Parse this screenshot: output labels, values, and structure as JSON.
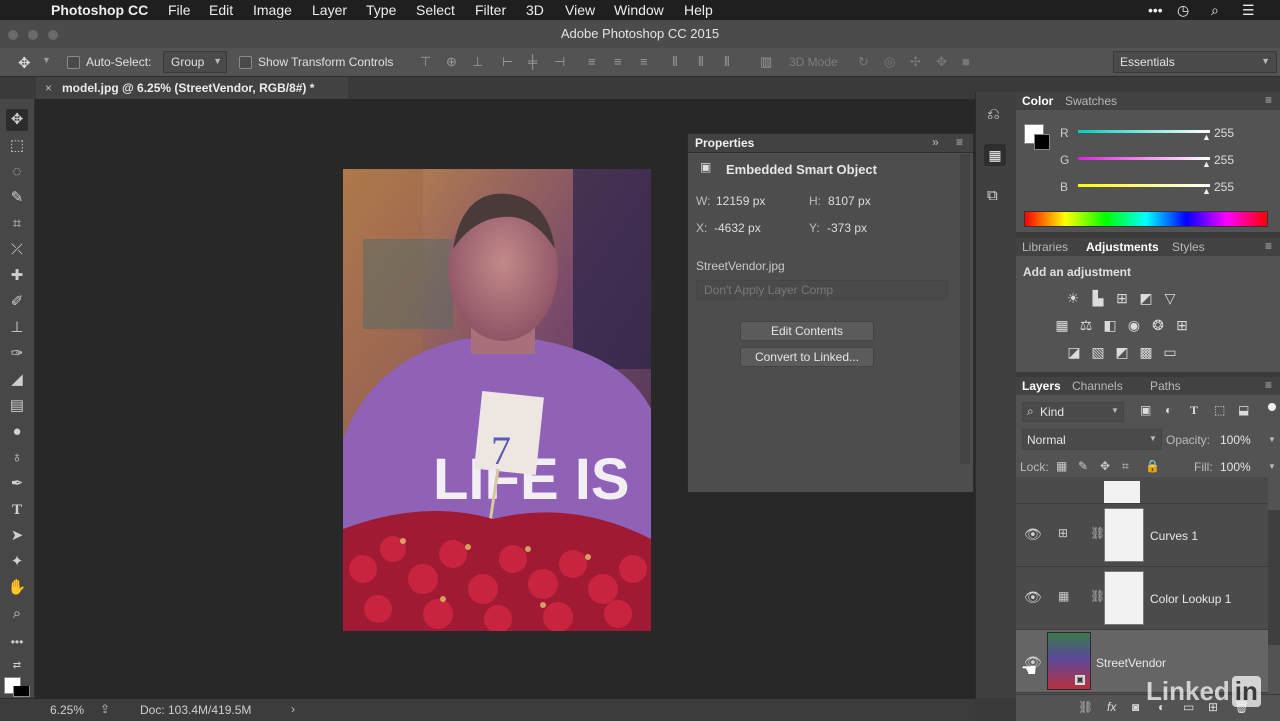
{
  "menubar": {
    "apple_glyph": "",
    "items": [
      "Photoshop CC",
      "File",
      "Edit",
      "Image",
      "Layer",
      "Type",
      "Select",
      "Filter",
      "3D",
      "View",
      "Window",
      "Help"
    ]
  },
  "window": {
    "title": "Adobe Photoshop CC 2015"
  },
  "options_bar": {
    "auto_select_label": "Auto-Select:",
    "auto_select_value": "Group",
    "show_transform_label": "Show Transform Controls",
    "mode_3d_label": "3D Mode",
    "workspace": "Essentials"
  },
  "document": {
    "tab_title": "model.jpg @ 6.25% (StreetVendor, RGB/8#) *",
    "close_glyph": "×",
    "photo_caption_text": "LIFE IS"
  },
  "status_bar": {
    "zoom": "6.25%",
    "doc_info": "Doc: 103.4M/419.5M",
    "arrow": "›"
  },
  "properties": {
    "title": "Properties",
    "type_label": "Embedded Smart Object",
    "w_label": "W:",
    "w_value": "12159 px",
    "h_label": "H:",
    "h_value": "8107 px",
    "x_label": "X:",
    "x_value": "-4632 px",
    "y_label": "Y:",
    "y_value": "-373 px",
    "file_name": "StreetVendor.jpg",
    "layer_comp": "Don't Apply Layer Comp",
    "edit_contents": "Edit Contents",
    "convert_linked": "Convert to Linked..."
  },
  "color_panel": {
    "tabs": [
      "Color",
      "Swatches"
    ],
    "channels": [
      {
        "label": "R",
        "value": "255",
        "color": "#ff4a4a"
      },
      {
        "label": "G",
        "value": "255",
        "color": "#4aff6a"
      },
      {
        "label": "B",
        "value": "255",
        "color": "#4a6aff"
      }
    ]
  },
  "adjustments_panel": {
    "tabs": [
      "Libraries",
      "Adjustments",
      "Styles"
    ],
    "heading": "Add an adjustment",
    "icons_row1": [
      "brightness-icon",
      "levels-icon",
      "curves-icon",
      "exposure-icon",
      "vibrance-icon"
    ],
    "icons_row2": [
      "hue-saturation-icon",
      "color-balance-icon",
      "black-white-icon",
      "photo-filter-icon",
      "channel-mixer-icon",
      "color-lookup-icon"
    ],
    "icons_row3": [
      "invert-icon",
      "posterize-icon",
      "threshold-icon",
      "selective-color-icon",
      "gradient-map-icon"
    ]
  },
  "layers_panel": {
    "tabs": [
      "Layers",
      "Channels",
      "Paths"
    ],
    "filter_kind": "Kind",
    "blend_mode": "Normal",
    "opacity_label": "Opacity:",
    "opacity_value": "100%",
    "lock_label": "Lock:",
    "fill_label": "Fill:",
    "fill_value": "100%",
    "layers": [
      {
        "name": "Curves 1"
      },
      {
        "name": "Color Lookup 1"
      },
      {
        "name": "StreetVendor"
      }
    ]
  },
  "watermark": {
    "text": "Linked",
    "suffix": "in"
  }
}
